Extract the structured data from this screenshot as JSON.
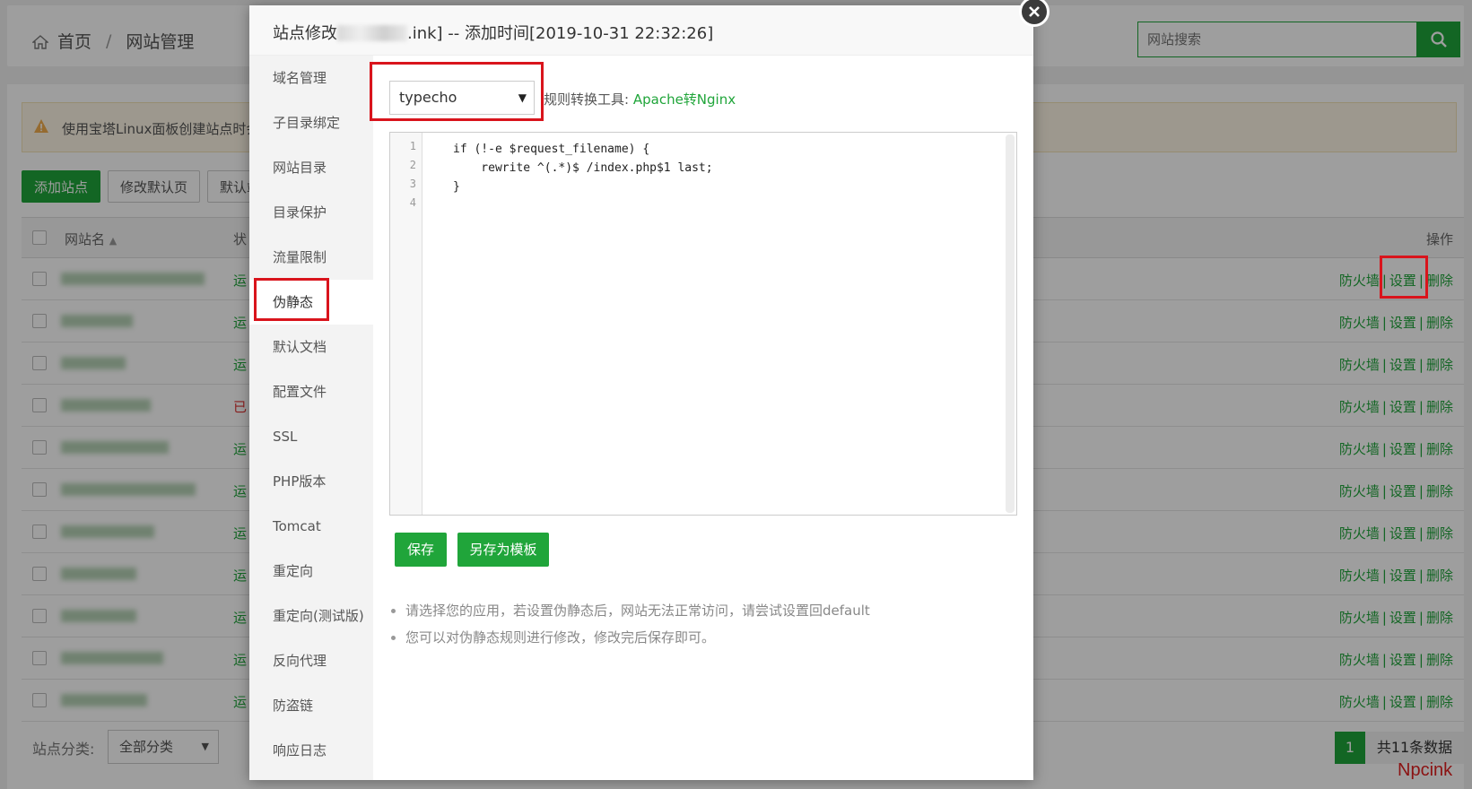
{
  "breadcrumb": {
    "home": "首页",
    "separator": "/",
    "current": "网站管理"
  },
  "search": {
    "placeholder": "网站搜索"
  },
  "alert": {
    "text": "使用宝塔Linux面板创建站点时会"
  },
  "toolbar": {
    "add_site": "添加站点",
    "edit_default_page": "修改默认页",
    "default_site": "默认站"
  },
  "table": {
    "col_name": "网站名",
    "col_status": "状",
    "col_ops": "操作",
    "rows": [
      {
        "status": "运",
        "ops": [
          "防火墙",
          "设置",
          "删除"
        ]
      },
      {
        "status": "运",
        "ops": [
          "防火墙",
          "设置",
          "删除"
        ]
      },
      {
        "status": "运",
        "ops": [
          "防火墙",
          "设置",
          "删除"
        ]
      },
      {
        "status": "已",
        "ops": [
          "防火墙",
          "设置",
          "删除"
        ]
      },
      {
        "status": "运",
        "ops": [
          "防火墙",
          "设置",
          "删除"
        ]
      },
      {
        "status": "运",
        "ops": [
          "防火墙",
          "设置",
          "删除"
        ]
      },
      {
        "status": "运",
        "ops": [
          "防火墙",
          "设置",
          "删除"
        ]
      },
      {
        "status": "运",
        "ops": [
          "防火墙",
          "设置",
          "删除"
        ]
      },
      {
        "status": "运",
        "ops": [
          "防火墙",
          "设置",
          "删除"
        ]
      },
      {
        "status": "运",
        "ops": [
          "防火墙",
          "设置",
          "删除"
        ]
      },
      {
        "status": "运",
        "ops": [
          "防火墙",
          "设置",
          "删除"
        ]
      }
    ]
  },
  "footer": {
    "category_label": "站点分类:",
    "category_value": "全部分类",
    "page": "1",
    "total": "共11条数据",
    "watermark": "Npcink"
  },
  "modal": {
    "title_prefix": "站点修改",
    "title_suffix": ".ink] -- 添加时间[2019-10-31 22:32:26]",
    "close_icon": "close-icon",
    "side_items": [
      "域名管理",
      "子目录绑定",
      "网站目录",
      "目录保护",
      "流量限制",
      "伪静态",
      "默认文档",
      "配置文件",
      "SSL",
      "PHP版本",
      "Tomcat",
      "重定向",
      "重定向(测试版)",
      "反向代理",
      "防盗链",
      "响应日志"
    ],
    "active_side_item": "伪静态",
    "rewrite_select": "typecho",
    "rule_tool_label": "规则转换工具:",
    "rule_tool_link": "Apache转Nginx",
    "editor": {
      "line_numbers": [
        "1",
        "2",
        "3",
        "4"
      ],
      "lines": [
        "if (!-e $request_filename) {",
        "    rewrite ^(.*)$ /index.php$1 last;",
        "}",
        ""
      ]
    },
    "save_button": "保存",
    "save_template_button": "另存为模板",
    "tips": [
      "请选择您的应用，若设置伪静态后，网站无法正常访问，请尝试设置回default",
      "您可以对伪静态规则进行修改，修改完后保存即可。"
    ]
  },
  "colors": {
    "accent": "#20a53a",
    "highlight_box": "#d9141c",
    "stopped": "#dd3333"
  }
}
